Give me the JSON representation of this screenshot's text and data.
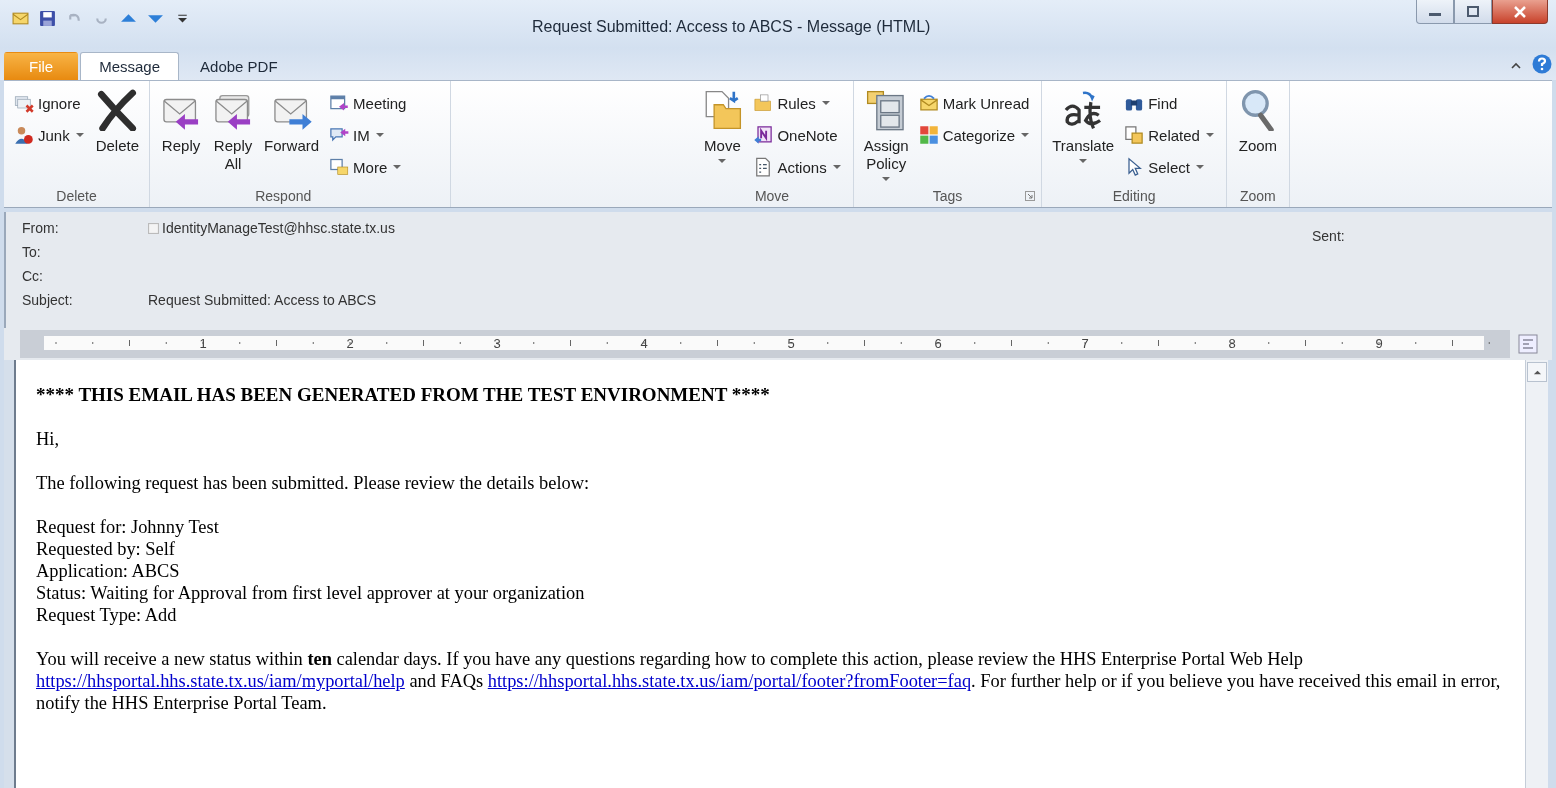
{
  "window": {
    "title": "Request Submitted: Access to ABCS  - Message (HTML)"
  },
  "tabs": [
    {
      "label": "File",
      "kind": "file",
      "selected": false
    },
    {
      "label": "Message",
      "kind": "tab",
      "selected": true
    },
    {
      "label": "Adobe PDF",
      "kind": "tab",
      "selected": false
    }
  ],
  "ribbon": {
    "groups": [
      {
        "label": "Delete",
        "dialog_launcher": false,
        "items": [
          {
            "kind": "small",
            "label": "Ignore",
            "dropdown": false
          },
          {
            "kind": "small",
            "label": "Junk",
            "dropdown": true
          },
          {
            "kind": "large",
            "label": "Delete",
            "dropdown": false
          }
        ]
      },
      {
        "label": "Respond",
        "dialog_launcher": false,
        "items": [
          {
            "kind": "large",
            "label": "Reply",
            "dropdown": false
          },
          {
            "kind": "large",
            "label": "Reply All",
            "dropdown": false
          },
          {
            "kind": "large",
            "label": "Forward",
            "dropdown": false
          },
          {
            "kind": "small",
            "label": "Meeting",
            "dropdown": false
          },
          {
            "kind": "small",
            "label": "IM",
            "dropdown": true
          },
          {
            "kind": "small",
            "label": "More",
            "dropdown": true
          }
        ]
      },
      {
        "label": "Move",
        "dialog_launcher": false,
        "items": [
          {
            "kind": "large",
            "label": "Move",
            "dropdown": true
          },
          {
            "kind": "small",
            "label": "Rules",
            "dropdown": true
          },
          {
            "kind": "small",
            "label": "OneNote",
            "dropdown": false
          },
          {
            "kind": "small",
            "label": "Actions",
            "dropdown": true
          }
        ]
      },
      {
        "label": "Tags",
        "dialog_launcher": true,
        "items": [
          {
            "kind": "large",
            "label": "Assign Policy",
            "dropdown": true
          },
          {
            "kind": "small",
            "label": "Mark Unread",
            "dropdown": false
          },
          {
            "kind": "small",
            "label": "Categorize",
            "dropdown": true
          }
        ]
      },
      {
        "label": "Editing",
        "dialog_launcher": false,
        "items": [
          {
            "kind": "large",
            "label": "Translate",
            "dropdown": true
          },
          {
            "kind": "small",
            "label": "Find",
            "dropdown": false
          },
          {
            "kind": "small",
            "label": "Related",
            "dropdown": true
          },
          {
            "kind": "small",
            "label": "Select",
            "dropdown": true
          }
        ]
      },
      {
        "label": "Zoom",
        "dialog_launcher": false,
        "items": [
          {
            "kind": "large",
            "label": "Zoom",
            "dropdown": false
          }
        ]
      }
    ]
  },
  "header": {
    "fields": [
      {
        "label": "From:",
        "value": "IdentityManageTest@hhsc.state.tx.us"
      },
      {
        "label": "To:"
      },
      {
        "label": "Cc:"
      },
      {
        "label": "Subject:",
        "value": "Request Submitted: Access to ABCS"
      }
    ],
    "sent_label": "Sent:"
  },
  "ruler": {
    "numbers": [
      "1",
      "2",
      "3",
      "4",
      "5",
      "6",
      "7",
      "8",
      "9"
    ]
  },
  "body": {
    "heading": "**** THIS EMAIL HAS BEEN GENERATED FROM THE TEST ENVIRONMENT ****",
    "greeting": "Hi,",
    "intro": "The following request has been submitted. Please review the details below:",
    "details": [
      "Request for: Johnny Test",
      "Requested by: Self",
      "Application: ABCS",
      "Status: Waiting for Approval from first level approver at your organization",
      "Request Type: Add"
    ],
    "closing": [
      {
        "kind": "text",
        "text": "You will receive a new status within **ten** calendar days. If you have any questions regarding how to complete this action, please review the HHS Enterprise Portal Web Help "
      },
      {
        "kind": "link",
        "text": "https://hhsportal.hhs.state.tx.us/iam/myportal/help"
      },
      {
        "kind": "text",
        "text": " and FAQs "
      },
      {
        "kind": "link",
        "text": "https://hhsportal.hhs.state.tx.us/iam/portal/footer?fromFooter=faq"
      },
      {
        "kind": "text",
        "text": ". For further help or if you believe you have received this email in error, notify the HHS Enterprise Portal Team."
      }
    ]
  }
}
